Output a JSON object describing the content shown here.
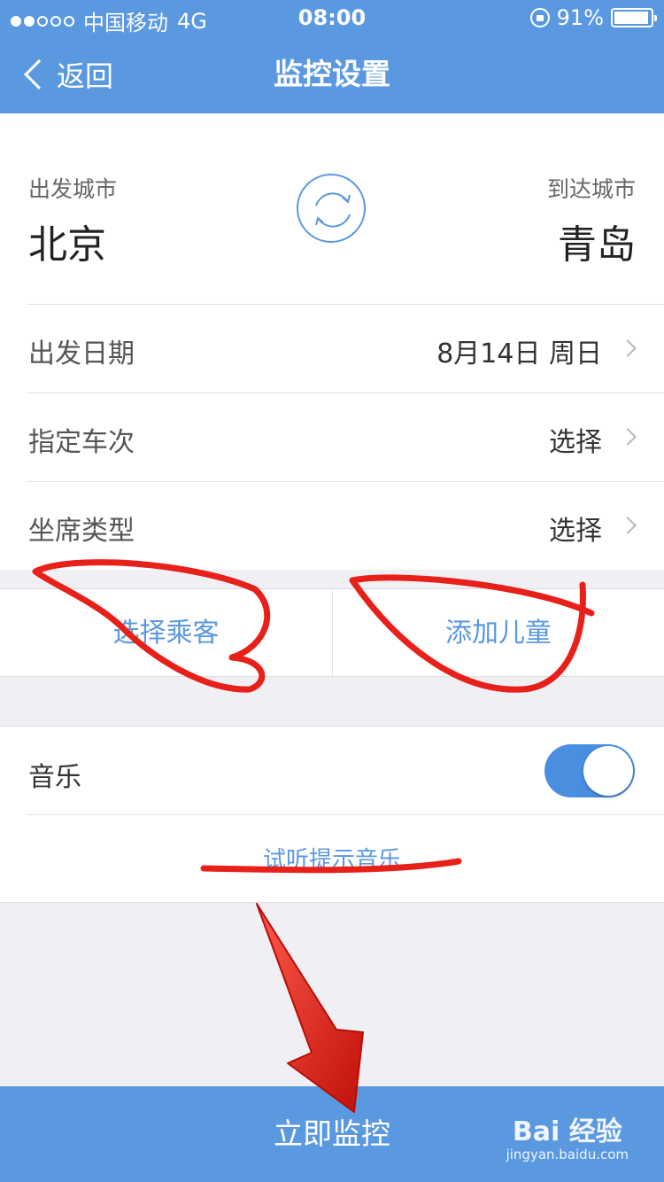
{
  "status_bar": {
    "carrier": "中国移动",
    "network": "4G",
    "time": "08:00",
    "battery": "91%"
  },
  "nav": {
    "back_label": "返回",
    "title": "监控设置"
  },
  "route": {
    "from_label": "出发城市",
    "from_city": "北京",
    "to_label": "到达城市",
    "to_city": "青岛"
  },
  "form": {
    "date": {
      "label": "出发日期",
      "value": "8月14日 周日"
    },
    "train": {
      "label": "指定车次",
      "value": "选择"
    },
    "seat": {
      "label": "坐席类型",
      "value": "选择"
    }
  },
  "passengers": {
    "select_label": "选择乘客",
    "add_child_label": "添加儿童"
  },
  "music": {
    "label": "音乐",
    "enabled": true,
    "preview_label": "试听提示音乐"
  },
  "start_label": "立即监控",
  "watermark": {
    "main": "Bai 经验",
    "sub": "jingyan.baidu.com"
  },
  "colors": {
    "primary": "#5a98e0",
    "annotation": "#e8201a"
  }
}
